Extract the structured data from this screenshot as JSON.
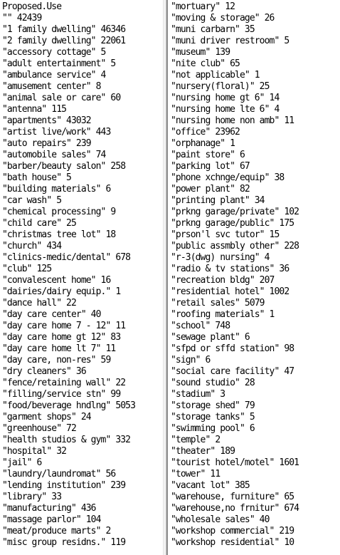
{
  "left_pane": {
    "lines": [
      "Proposed.Use",
      "\"\" 42439",
      "\"1 family dwelling\" 46346",
      "\"2 family dwelling\" 22061",
      "\"accessory cottage\" 5",
      "\"adult entertainment\" 5",
      "\"ambulance service\" 4",
      "\"amusement center\" 8",
      "\"animal sale or care\" 60",
      "\"antenna\" 115",
      "\"apartments\" 43032",
      "\"artist live/work\" 443",
      "\"auto repairs\" 239",
      "\"automobile sales\" 74",
      "\"barber/beauty salon\" 258",
      "\"bath house\" 5",
      "\"building materials\" 6",
      "\"car wash\" 5",
      "\"chemical processing\" 9",
      "\"child care\" 25",
      "\"christmas tree lot\" 18",
      "\"church\" 434",
      "\"clinics-medic/dental\" 678",
      "\"club\" 125",
      "\"convalescent home\" 16",
      "\"dairies/dairy equip.\" 1",
      "\"dance hall\" 22",
      "\"day care center\" 40",
      "\"day care home 7 - 12\" 11",
      "\"day care home gt 12\" 83",
      "\"day care home lt 7\" 11",
      "\"day care, non-res\" 59",
      "\"dry cleaners\" 36",
      "\"fence/retaining wall\" 22",
      "\"filling/service stn\" 99",
      "\"food/beverage hndlng\" 5053",
      "\"garment shops\" 24",
      "\"greenhouse\" 72",
      "\"health studios & gym\" 332",
      "\"hospital\" 32",
      "\"jail\" 6",
      "\"laundry/laundromat\" 56",
      "\"lending institution\" 239",
      "\"library\" 33",
      "\"manufacturing\" 436",
      "\"massage parlor\" 104",
      "\"meat/produce marts\" 2",
      "\"misc group residns.\" 119"
    ]
  },
  "right_pane": {
    "lines": [
      "\"mortuary\" 12",
      "\"moving & storage\" 26",
      "\"muni carbarn\" 35",
      "\"muni driver restroom\" 5",
      "\"museum\" 139",
      "\"nite club\" 65",
      "\"not applicable\" 1",
      "\"nursery(floral)\" 25",
      "\"nursing home gt 6\" 14",
      "\"nursing home lte 6\" 4",
      "\"nursing home non amb\" 11",
      "\"office\" 23962",
      "\"orphanage\" 1",
      "\"paint store\" 6",
      "\"parking lot\" 67",
      "\"phone xchnge/equip\" 38",
      "\"power plant\" 82",
      "\"printing plant\" 34",
      "\"prkng garage/private\" 102",
      "\"prkng garage/public\" 175",
      "\"prson'l svc tutor\" 15",
      "\"public assmbly other\" 228",
      "\"r-3(dwg) nursing\" 4",
      "\"radio & tv stations\" 36",
      "\"recreation bldg\" 207",
      "\"residential hotel\" 1002",
      "\"retail sales\" 5079",
      "\"roofing materials\" 1",
      "\"school\" 748",
      "\"sewage plant\" 6",
      "\"sfpd or sffd station\" 98",
      "\"sign\" 6",
      "\"social care facility\" 47",
      "\"sound studio\" 28",
      "\"stadium\" 3",
      "\"storage shed\" 79",
      "\"storage tanks\" 5",
      "\"swimming pool\" 6",
      "\"temple\" 2",
      "\"theater\" 189",
      "\"tourist hotel/motel\" 1601",
      "\"tower\" 11",
      "\"vacant lot\" 385",
      "\"warehouse, furniture\" 65",
      "\"warehouse,no frnitur\" 674",
      "\"wholesale sales\" 40",
      "\"workshop commercial\" 219",
      "\"workshop residential\" 10"
    ]
  }
}
